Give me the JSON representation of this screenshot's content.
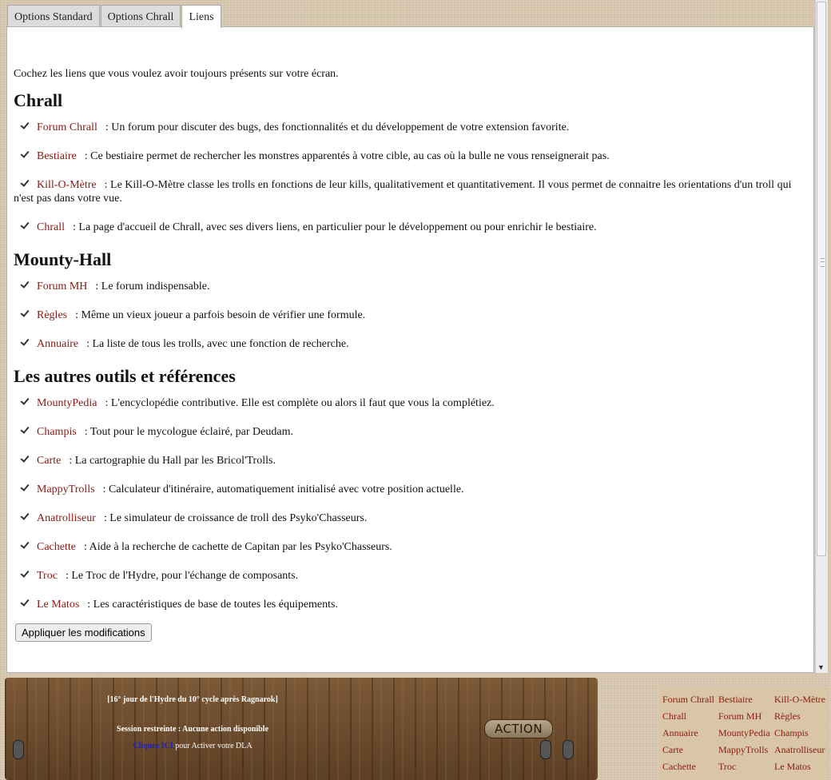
{
  "tabs": [
    {
      "label": "Options Standard"
    },
    {
      "label": "Options Chrall"
    },
    {
      "label": "Liens"
    }
  ],
  "intro": "Cochez les liens que vous voulez avoir toujours présents sur votre écran.",
  "sections": [
    {
      "title": "Chrall",
      "items": [
        {
          "name": "Forum Chrall",
          "desc": ": Un forum pour discuter des bugs, des fonctionnalités et du développement de votre extension favorite.",
          "checked": true
        },
        {
          "name": "Bestiaire",
          "desc": ": Ce bestiaire permet de rechercher les monstres apparentés à votre cible, au cas où la bulle ne vous renseignerait pas.",
          "checked": true
        },
        {
          "name": "Kill-O-Mètre",
          "desc": ": Le Kill-O-Mètre classe les trolls en fonctions de leur kills, qualitativement et quantitativement. Il vous permet de connaitre les orientations d'un troll qui n'est pas dans votre vue.",
          "checked": true
        },
        {
          "name": "Chrall",
          "desc": ": La page d'accueil de Chrall, avec ses divers liens, en particulier pour le développement ou pour enrichir le bestiaire.",
          "checked": true
        }
      ]
    },
    {
      "title": "Mounty-Hall",
      "items": [
        {
          "name": "Forum MH",
          "desc": ": Le forum indispensable.",
          "checked": true
        },
        {
          "name": "Règles",
          "desc": ": Même un vieux joueur a parfois besoin de vérifier une formule.",
          "checked": true
        },
        {
          "name": "Annuaire",
          "desc": ": La liste de tous les trolls, avec une fonction de recherche.",
          "checked": true
        }
      ]
    },
    {
      "title": "Les autres outils et références",
      "items": [
        {
          "name": "MountyPedia",
          "desc": ": L'encyclopédie contributive. Elle est complète ou alors il faut que vous la complétiez.",
          "checked": true
        },
        {
          "name": "Champis",
          "desc": ": Tout pour le mycologue éclairé, par Deudam.",
          "checked": true
        },
        {
          "name": "Carte",
          "desc": ": La cartographie du Hall par les Bricol'Trolls.",
          "checked": true
        },
        {
          "name": "MappyTrolls",
          "desc": ": Calculateur d'itinéraire, automatiquement initialisé avec votre position actuelle.",
          "checked": true
        },
        {
          "name": "Anatrolliseur",
          "desc": ": Le simulateur de croissance de troll des Psyko'Chasseurs.",
          "checked": true
        },
        {
          "name": "Cachette",
          "desc": ": Aide à la recherche de cachette de Capitan par les Psyko'Chasseurs.",
          "checked": true
        },
        {
          "name": "Troc",
          "desc": ": Le Troc de l'Hydre, pour l'échange de composants.",
          "checked": true
        },
        {
          "name": "Le Matos",
          "desc": ": Les caractéristiques de base de toutes les équipements.",
          "checked": true
        }
      ]
    }
  ],
  "apply_button": "Appliquer les modifications",
  "bottom": {
    "date": "[16° jour de l'Hydre du 10° cycle après Ragnarok]",
    "session": "Session restreinte : Aucune action disponible",
    "clique_link": "Cliquez ICI",
    "clique_rest": " pour Activer votre DLA",
    "action_label": "ACTION"
  },
  "quick_links": [
    [
      "Forum Chrall",
      "Bestiaire",
      "Kill-O-Mètre"
    ],
    [
      "Chrall",
      "Forum MH",
      "Règles"
    ],
    [
      "Annuaire",
      "MountyPedia",
      "Champis"
    ],
    [
      "Carte",
      "MappyTrolls",
      "Anatrolliseur"
    ],
    [
      "Cachette",
      "Troc",
      "Le Matos"
    ]
  ],
  "colors": {
    "link": "#8a1a14",
    "clique_link": "#1a22cc",
    "wood": "#6a4a2c"
  }
}
